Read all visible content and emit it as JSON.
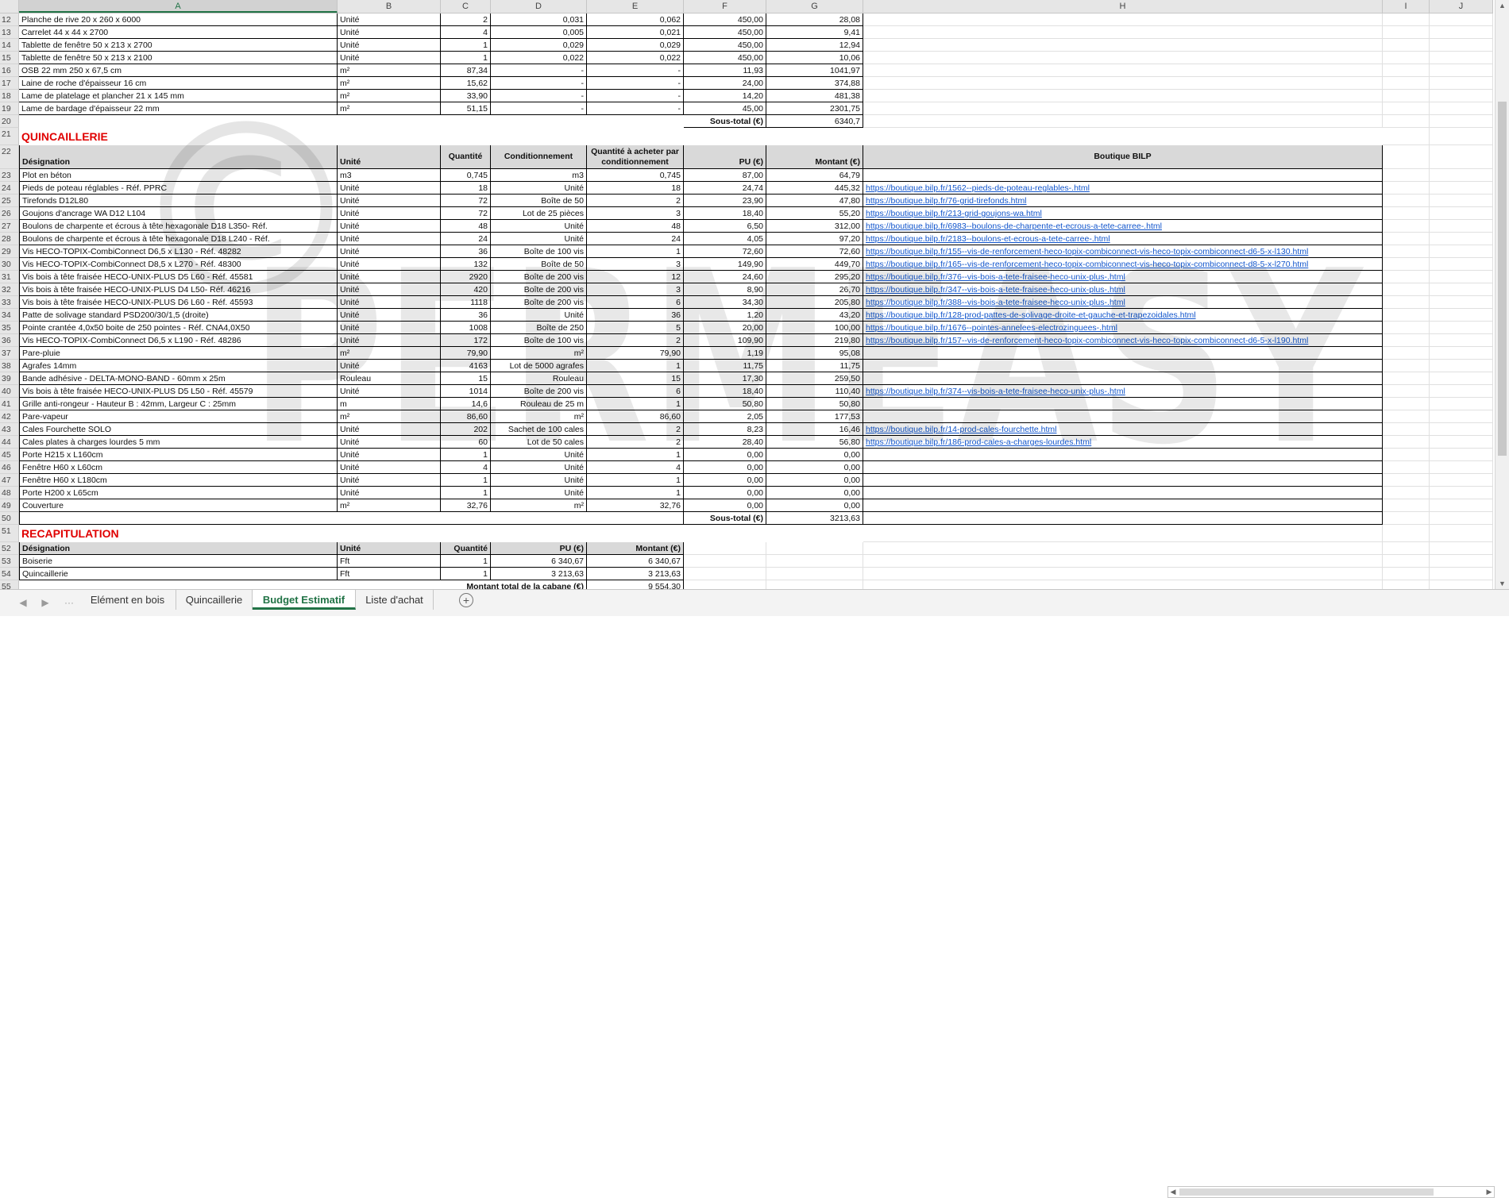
{
  "columns": [
    "A",
    "B",
    "C",
    "D",
    "E",
    "F",
    "G",
    "H",
    "I",
    "J"
  ],
  "boiserie_rows": [
    {
      "n": "12",
      "a": "Planche de rive 20 x 260 x 6000",
      "b": "Unité",
      "c": "2",
      "d": "0,031",
      "e": "0,062",
      "f": "450,00",
      "g": "28,08"
    },
    {
      "n": "13",
      "a": "Carrelet 44 x 44 x 2700",
      "b": "Unité",
      "c": "4",
      "d": "0,005",
      "e": "0,021",
      "f": "450,00",
      "g": "9,41"
    },
    {
      "n": "14",
      "a": "Tablette de fenêtre 50 x 213 x 2700",
      "b": "Unité",
      "c": "1",
      "d": "0,029",
      "e": "0,029",
      "f": "450,00",
      "g": "12,94"
    },
    {
      "n": "15",
      "a": "Tablette de fenêtre 50 x 213 x 2100",
      "b": "Unité",
      "c": "1",
      "d": "0,022",
      "e": "0,022",
      "f": "450,00",
      "g": "10,06"
    },
    {
      "n": "16",
      "a": "OSB 22 mm 250 x 67,5 cm",
      "b": "m²",
      "c": "87,34",
      "d": "-",
      "e": "-",
      "f": "11,93",
      "g": "1041,97"
    },
    {
      "n": "17",
      "a": "Laine de roche d'épaisseur 16 cm",
      "b": "m²",
      "c": "15,62",
      "d": "-",
      "e": "-",
      "f": "24,00",
      "g": "374,88"
    },
    {
      "n": "18",
      "a": "Lame de platelage et plancher 21 x 145 mm",
      "b": "m²",
      "c": "33,90",
      "d": "-",
      "e": "-",
      "f": "14,20",
      "g": "481,38"
    },
    {
      "n": "19",
      "a": "Lame de bardage d'épaisseur 22 mm",
      "b": "m²",
      "c": "51,15",
      "d": "-",
      "e": "-",
      "f": "45,00",
      "g": "2301,75"
    }
  ],
  "row20": {
    "n": "20",
    "label": "Sous-total (€)",
    "value": "6340,7"
  },
  "quincaillerie_title": {
    "n": "21",
    "text": "QUINCAILLERIE"
  },
  "quinc_header": {
    "n": "22",
    "a": "Désignation",
    "b": "Unité",
    "c": "Quantité",
    "d": "Conditionnement",
    "e": "Quantité à acheter par conditionnement",
    "f": "PU (€)",
    "g": "Montant (€)",
    "h": "Boutique BILP"
  },
  "quinc_rows": [
    {
      "n": "23",
      "a": "Plot en béton",
      "b": "m3",
      "c": "0,745",
      "d": "m3",
      "e": "0,745",
      "f": "87,00",
      "g": "64,79",
      "h": ""
    },
    {
      "n": "24",
      "a": "Pieds de poteau réglables - Réf. PPRC",
      "b": "Unité",
      "c": "18",
      "d": "Unité",
      "e": "18",
      "f": "24,74",
      "g": "445,32",
      "h": "https://boutique.bilp.fr/1562--pieds-de-poteau-reglables-.html"
    },
    {
      "n": "25",
      "a": "Tirefonds D12L80",
      "b": "Unité",
      "c": "72",
      "d": "Boîte de 50",
      "e": "2",
      "f": "23,90",
      "g": "47,80",
      "h": "https://boutique.bilp.fr/76-grid-tirefonds.html"
    },
    {
      "n": "26",
      "a": "Goujons d'ancrage WA D12 L104",
      "b": "Unité",
      "c": "72",
      "d": "Lot de 25 pièces",
      "e": "3",
      "f": "18,40",
      "g": "55,20",
      "h": "https://boutique.bilp.fr/213-grid-goujons-wa.html"
    },
    {
      "n": "27",
      "a": "Boulons de charpente et écrous à tête hexagonale D18 L350- Réf.",
      "b": "Unité",
      "c": "48",
      "d": "Unité",
      "e": "48",
      "f": "6,50",
      "g": "312,00",
      "h": "https://boutique.bilp.fr/6983--boulons-de-charpente-et-ecrous-a-tete-carree-.html"
    },
    {
      "n": "28",
      "a": "Boulons de charpente et écrous à tête hexagonale D18 L240 - Réf.",
      "b": "Unité",
      "c": "24",
      "d": "Unité",
      "e": "24",
      "f": "4,05",
      "g": "97,20",
      "h": "https://boutique.bilp.fr/2183--boulons-et-ecrous-a-tete-carree-.html"
    },
    {
      "n": "29",
      "a": "Vis HECO-TOPIX-CombiConnect D6,5 x L130 - Réf. 48282",
      "b": "Unité",
      "c": "36",
      "d": "Boîte de 100 vis",
      "e": "1",
      "f": "72,60",
      "g": "72,60",
      "h": "https://boutique.bilp.fr/155--vis-de-renforcement-heco-topix-combiconnect-vis-heco-topix-combiconnect-d6-5-x-l130.html"
    },
    {
      "n": "30",
      "a": "Vis HECO-TOPIX-CombiConnect D8,5 x L270 - Réf. 48300",
      "b": "Unité",
      "c": "132",
      "d": "Boîte de 50",
      "e": "3",
      "f": "149,90",
      "g": "449,70",
      "h": "https://boutique.bilp.fr/165--vis-de-renforcement-heco-topix-combiconnect-vis-heco-topix-combiconnect-d8-5-x-l270.html"
    },
    {
      "n": "31",
      "a": "Vis bois à tête fraisée HECO-UNIX-PLUS D5 L60 - Réf. 45581",
      "b": "Unité",
      "c": "2920",
      "d": "Boîte de 200 vis",
      "e": "12",
      "f": "24,60",
      "g": "295,20",
      "h": "https://boutique.bilp.fr/376--vis-bois-a-tete-fraisee-heco-unix-plus-.html"
    },
    {
      "n": "32",
      "a": "Vis bois à tête fraisée HECO-UNIX-PLUS D4 L50- Réf. 46216",
      "b": "Unité",
      "c": "420",
      "d": "Boîte de 200 vis",
      "e": "3",
      "f": "8,90",
      "g": "26,70",
      "h": "https://boutique.bilp.fr/347--vis-bois-a-tete-fraisee-heco-unix-plus-.html"
    },
    {
      "n": "33",
      "a": "Vis bois à tête fraisée HECO-UNIX-PLUS D6 L60 - Réf. 45593",
      "b": "Unité",
      "c": "1118",
      "d": "Boîte de 200 vis",
      "e": "6",
      "f": "34,30",
      "g": "205,80",
      "h": "https://boutique.bilp.fr/388--vis-bois-a-tete-fraisee-heco-unix-plus-.html"
    },
    {
      "n": "34",
      "a": "Patte de solivage standard PSD200/30/1,5 (droite)",
      "b": "Unité",
      "c": "36",
      "d": "Unité",
      "e": "36",
      "f": "1,20",
      "g": "43,20",
      "h": "https://boutique.bilp.fr/128-prod-pattes-de-solivage-droite-et-gauche-et-trapezoidales.html"
    },
    {
      "n": "35",
      "a": "Pointe crantée 4,0x50 boite de 250 pointes - Réf. CNA4,0X50",
      "b": "Unité",
      "c": "1008",
      "d": "Boîte de 250",
      "e": "5",
      "f": "20,00",
      "g": "100,00",
      "h": "https://boutique.bilp.fr/1676--pointes-annelees-electrozinguees-.html"
    },
    {
      "n": "36",
      "a": "Vis HECO-TOPIX-CombiConnect D6,5 x L190 - Réf. 48286",
      "b": "Unité",
      "c": "172",
      "d": "Boîte de 100 vis",
      "e": "2",
      "f": "109,90",
      "g": "219,80",
      "h": "https://boutique.bilp.fr/157--vis-de-renforcement-heco-topix-combiconnect-vis-heco-topix-combiconnect-d6-5-x-l190.html"
    },
    {
      "n": "37",
      "a": "Pare-pluie",
      "b": "m²",
      "c": "79,90",
      "d": "m²",
      "e": "79,90",
      "f": "1,19",
      "g": "95,08",
      "h": ""
    },
    {
      "n": "38",
      "a": "Agrafes 14mm",
      "b": "Unité",
      "c": "4163",
      "d": "Lot de 5000 agrafes",
      "e": "1",
      "f": "11,75",
      "g": "11,75",
      "h": ""
    },
    {
      "n": "39",
      "a": "Bande adhésive - DELTA-MONO-BAND - 60mm x 25m",
      "b": "Rouleau",
      "c": "15",
      "d": "Rouleau",
      "e": "15",
      "f": "17,30",
      "g": "259,50",
      "h": ""
    },
    {
      "n": "40",
      "a": "Vis bois à tête fraisée HECO-UNIX-PLUS D5 L50 - Réf. 45579",
      "b": "Unité",
      "c": "1014",
      "d": "Boîte de 200 vis",
      "e": "6",
      "f": "18,40",
      "g": "110,40",
      "h": "https://boutique.bilp.fr/374--vis-bois-a-tete-fraisee-heco-unix-plus-.html"
    },
    {
      "n": "41",
      "a": "Grille anti-rongeur - Hauteur B : 42mm, Largeur C : 25mm",
      "b": "m",
      "c": "14,6",
      "d": "Rouleau de 25 m",
      "e": "1",
      "f": "50,80",
      "g": "50,80",
      "h": ""
    },
    {
      "n": "42",
      "a": "Pare-vapeur",
      "b": "m²",
      "c": "86,60",
      "d": "m²",
      "e": "86,60",
      "f": "2,05",
      "g": "177,53",
      "h": ""
    },
    {
      "n": "43",
      "a": "Cales Fourchette SOLO",
      "b": "Unité",
      "c": "202",
      "d": "Sachet de 100 cales",
      "e": "2",
      "f": "8,23",
      "g": "16,46",
      "h": "https://boutique.bilp.fr/14-prod-cales-fourchette.html"
    },
    {
      "n": "44",
      "a": "Cales plates à charges lourdes 5 mm",
      "b": "Unité",
      "c": "60",
      "d": "Lot de 50 cales",
      "e": "2",
      "f": "28,40",
      "g": "56,80",
      "h": "https://boutique.bilp.fr/186-prod-cales-a-charges-lourdes.html"
    },
    {
      "n": "45",
      "a": "Porte H215 x L160cm",
      "b": "Unité",
      "c": "1",
      "d": "Unité",
      "e": "1",
      "f": "0,00",
      "g": "0,00",
      "h": ""
    },
    {
      "n": "46",
      "a": "Fenêtre H60 x L60cm",
      "b": "Unité",
      "c": "4",
      "d": "Unité",
      "e": "4",
      "f": "0,00",
      "g": "0,00",
      "h": ""
    },
    {
      "n": "47",
      "a": "Fenêtre H60 x L180cm",
      "b": "Unité",
      "c": "1",
      "d": "Unité",
      "e": "1",
      "f": "0,00",
      "g": "0,00",
      "h": ""
    },
    {
      "n": "48",
      "a": "Porte H200 x L65cm",
      "b": "Unité",
      "c": "1",
      "d": "Unité",
      "e": "1",
      "f": "0,00",
      "g": "0,00",
      "h": ""
    },
    {
      "n": "49",
      "a": "Couverture",
      "b": "m²",
      "c": "32,76",
      "d": "m²",
      "e": "32,76",
      "f": "0,00",
      "g": "0,00",
      "h": ""
    }
  ],
  "row50": {
    "n": "50",
    "label": "Sous-total (€)",
    "value": "3213,63"
  },
  "recap_title": {
    "n": "51",
    "text": "RECAPITULATION"
  },
  "recap_header": {
    "n": "52",
    "a": "Désignation",
    "b": "Unité",
    "c": "Quantité",
    "d": "PU (€)",
    "e": "Montant (€)"
  },
  "recap_rows": [
    {
      "n": "53",
      "a": "Boiserie",
      "b": "Fft",
      "c": "1",
      "d": "6 340,67",
      "e": "6 340,67"
    },
    {
      "n": "54",
      "a": "Quincaillerie",
      "b": "Fft",
      "c": "1",
      "d": "3 213,63",
      "e": "3 213,63"
    }
  ],
  "recap_total": {
    "n": "55",
    "label": "Montant total de la cabane (€)",
    "value": "9 554,30"
  },
  "tabs": [
    {
      "label": "Elément en bois",
      "active": false
    },
    {
      "label": "Quincaillerie",
      "active": false
    },
    {
      "label": "Budget Estimatif",
      "active": true
    },
    {
      "label": "Liste d'achat",
      "active": false
    }
  ],
  "nav": {
    "prev": "◀",
    "next": "▶",
    "more": "···",
    "add": "+"
  },
  "watermark_text": "PERMEASY",
  "watermark_symbol": "©"
}
